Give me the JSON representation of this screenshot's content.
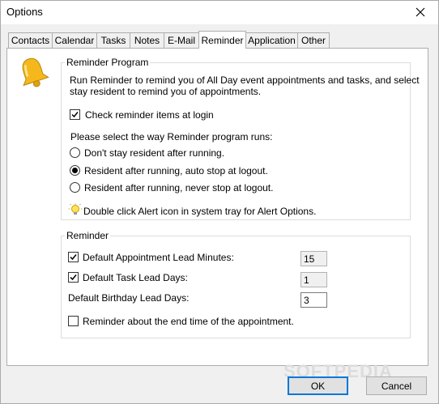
{
  "window": {
    "title": "Options"
  },
  "tabs": [
    {
      "label": "Contacts"
    },
    {
      "label": "Calendar"
    },
    {
      "label": "Tasks"
    },
    {
      "label": "Notes"
    },
    {
      "label": "E-Mail"
    },
    {
      "label": "Reminder"
    },
    {
      "label": "Application"
    },
    {
      "label": "Other"
    }
  ],
  "active_tab": "Reminder",
  "reminder_program": {
    "group_label": "Reminder Program",
    "description_line1": "Run Reminder to remind you of All Day event appointments and tasks, and select",
    "description_line2": "stay resident to remind you of appointments.",
    "check_at_login": {
      "label": "Check reminder items at login",
      "checked": true
    },
    "runs_prompt": "Please select the way Reminder program runs:",
    "options": [
      {
        "label": "Don't stay resident after running.",
        "selected": false
      },
      {
        "label": "Resident after running, auto stop at logout.",
        "selected": true
      },
      {
        "label": "Resident after running, never stop at logout.",
        "selected": false
      }
    ],
    "hint": "Double click Alert icon in system tray for Alert Options."
  },
  "reminder": {
    "group_label": "Reminder",
    "appointment_lead": {
      "label": "Default Appointment Lead Minutes:",
      "checked": true,
      "value": "15"
    },
    "task_lead": {
      "label": "Default Task Lead Days:",
      "checked": true,
      "value": "1"
    },
    "birthday_lead": {
      "label": "Default Birthday Lead Days:",
      "value": "3"
    },
    "end_time": {
      "label": "Reminder about the end time of the appointment.",
      "checked": false
    }
  },
  "buttons": {
    "ok": "OK",
    "cancel": "Cancel"
  },
  "watermark": "SOFTPEDIA",
  "icons": {
    "bell": "bell-icon",
    "bulb": "light-bulb-icon",
    "close": "close-icon"
  },
  "colors": {
    "accent": "#0078d7",
    "bell": "#f5b81c",
    "panel": "#ffffff",
    "chrome": "#f0f0f0"
  }
}
